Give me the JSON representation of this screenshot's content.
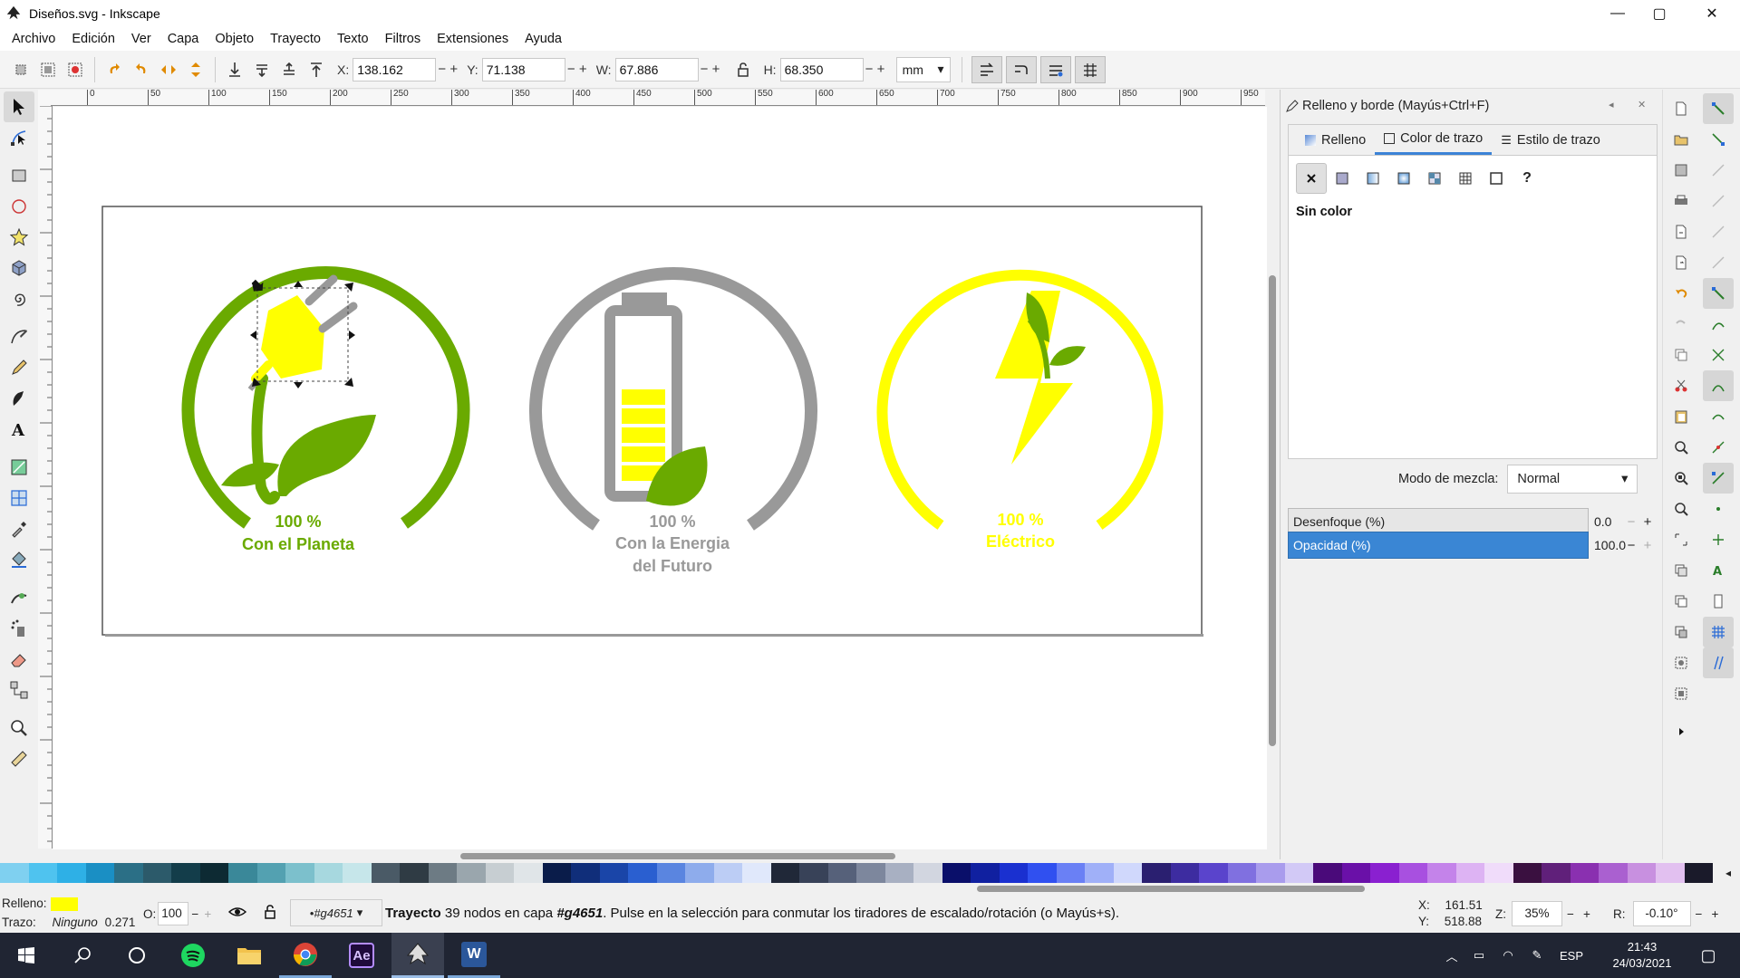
{
  "window": {
    "title": "Diseños.svg - Inkscape",
    "controls": {
      "minimize": "—",
      "maximize": "▢",
      "close": "✕"
    }
  },
  "menu": [
    "Archivo",
    "Edición",
    "Ver",
    "Capa",
    "Objeto",
    "Trayecto",
    "Texto",
    "Filtros",
    "Extensiones",
    "Ayuda"
  ],
  "toolbar": {
    "x_label": "X:",
    "x_value": "138.162",
    "y_label": "Y:",
    "y_value": "71.138",
    "w_label": "W:",
    "w_value": "67.886",
    "h_label": "H:",
    "h_value": "68.350",
    "unit": "mm",
    "minus": "−",
    "plus": "+"
  },
  "ruler_ticks": [
    "0",
    "50",
    "100",
    "150",
    "200",
    "250",
    "300",
    "350",
    "400",
    "450",
    "500",
    "550",
    "600",
    "650",
    "700",
    "750",
    "800",
    "850",
    "900",
    "950"
  ],
  "canvas": {
    "badges": [
      {
        "percent": "100 %",
        "line1": "Con el Planeta",
        "line2": "",
        "color": "#6aaa00"
      },
      {
        "percent": "100 %",
        "line1": "Con la Energia",
        "line2": "del Futuro",
        "color": "#999999"
      },
      {
        "percent": "100 %",
        "line1": "Eléctrico",
        "line2": "",
        "color": "#ffff00"
      }
    ]
  },
  "dialog": {
    "title": "Relleno y borde (Mayús+Ctrl+F)",
    "tabs": [
      "Relleno",
      "Color de trazo",
      "Estilo de trazo"
    ],
    "active_tab": "Color de trazo",
    "no_color_label": "Sin color",
    "help_glyph": "?",
    "blend_label": "Modo de mezcla:",
    "blend_value": "Normal",
    "blur_label": "Desenfoque (%)",
    "blur_value": "0.0",
    "opacity_label": "Opacidad (%)",
    "opacity_value": "100.0",
    "minus": "−",
    "plus": "+"
  },
  "status": {
    "fill_label": "Relleno:",
    "fill_color": "#ffff00",
    "stroke_label": "Trazo:",
    "stroke_value": "Ninguno",
    "stroke_width": "0.271",
    "opacity_label": "O:",
    "opacity_value": "100",
    "layer": "•#g4651",
    "message_type": "Trayecto",
    "message_mid": " 39 nodos en capa ",
    "message_layer": "#g4651",
    "message_tail": ". Pulse en la selección para conmutar los tiradores de escalado/rotación (o Mayús+s).",
    "cursor_x_label": "X:",
    "cursor_x": "161.51",
    "cursor_y_label": "Y:",
    "cursor_y": "518.88",
    "zoom_label": "Z:",
    "zoom": "35%",
    "rotation_label": "R:",
    "rotation": "-0.10°"
  },
  "taskbar": {
    "apps": [
      "start-icon",
      "search-icon",
      "cortana-icon",
      "spotify-icon",
      "file-explorer-icon",
      "chrome-icon",
      "after-effects-icon",
      "inkscape-icon",
      "word-icon"
    ],
    "ae_label": "Ae",
    "word_label": "W",
    "lang": "ESP",
    "time": "21:43",
    "date": "24/03/2021"
  }
}
